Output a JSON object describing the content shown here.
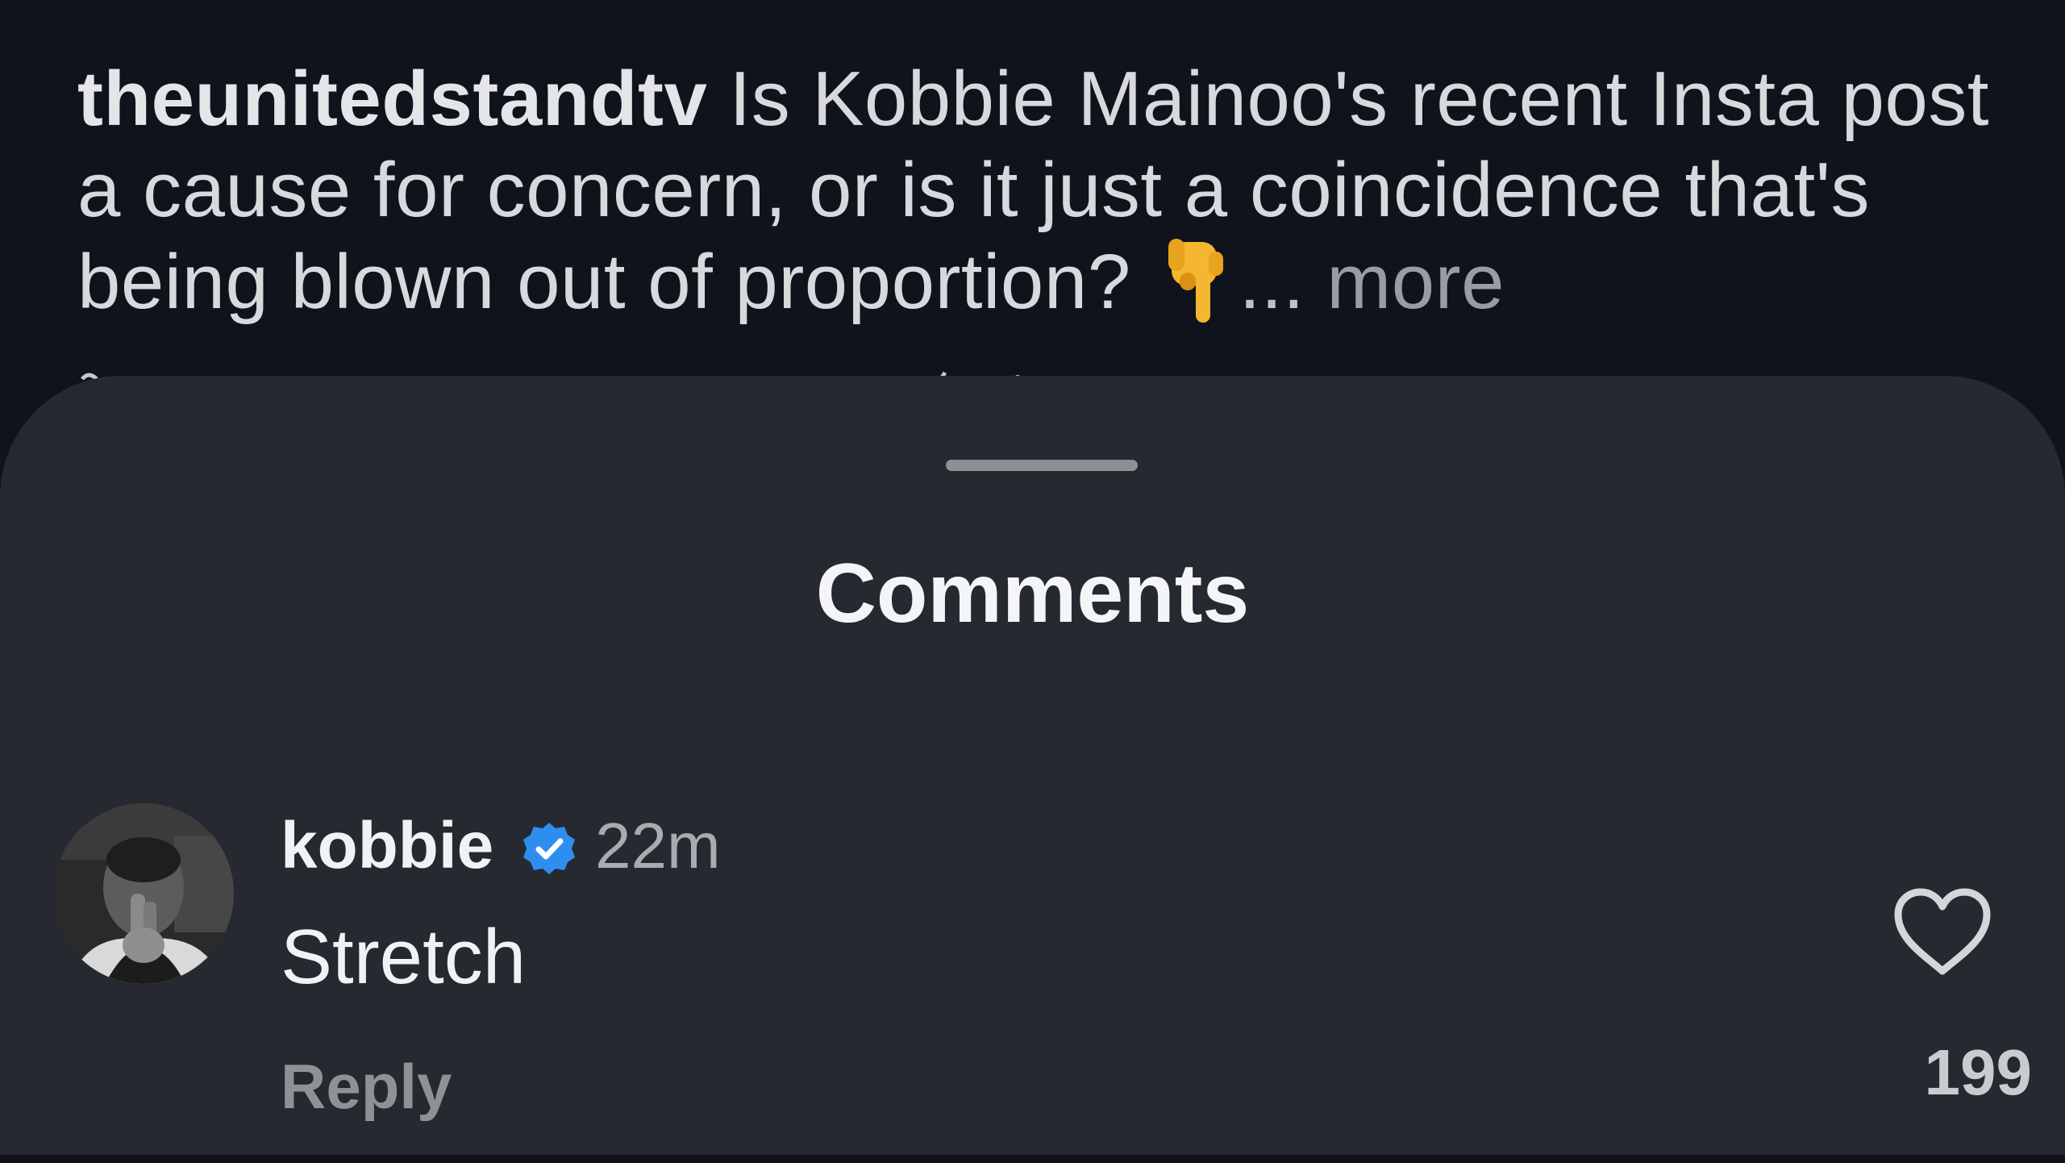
{
  "post": {
    "username": "theunitedstandtv",
    "caption": "Is Kobbie Mainoo's recent Insta post a cause for concern, or is it just a coincidence that's being blown out of proportion?",
    "emoji_icon": "pointing-down-hand-icon",
    "ellipsis": "...",
    "more_label": "more"
  },
  "sheet": {
    "title": "Comments"
  },
  "comment": {
    "username": "kobbie",
    "verified": true,
    "timestamp": "22m",
    "text": "Stretch",
    "reply_label": "Reply",
    "like_count": "199"
  },
  "colors": {
    "background": "#10131b",
    "sheet": "#262930",
    "verified_badge": "#2e8ef0",
    "emoji": "#f5b731"
  }
}
